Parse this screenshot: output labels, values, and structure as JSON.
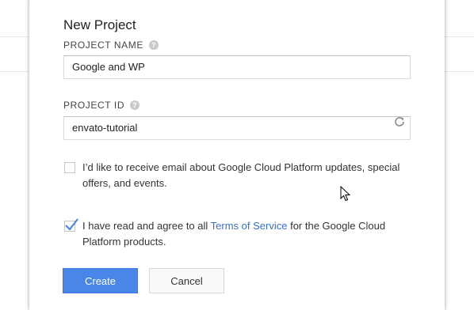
{
  "dialog": {
    "title": "New Project",
    "project_name": {
      "label": "PROJECT NAME",
      "value": "Google and WP",
      "help_icon": "question-circle-icon"
    },
    "project_id": {
      "label": "PROJECT ID",
      "value": "envato-tutorial",
      "help_icon": "question-circle-icon",
      "refresh_icon": "refresh-icon"
    },
    "email_opt_in": {
      "checked": false,
      "text": "I’d like to receive email about Google Cloud Platform updates, special offers, and events."
    },
    "terms": {
      "checked": true,
      "text_before": "I have read and agree to all ",
      "link_text": "Terms of Service",
      "text_after": " for the Google Cloud Platform products."
    },
    "buttons": {
      "create_label": "Create",
      "cancel_label": "Cancel"
    }
  },
  "colors": {
    "primary_button": "#4a86e8",
    "link": "#3a6fc9",
    "checkmark": "#4a86e8"
  }
}
